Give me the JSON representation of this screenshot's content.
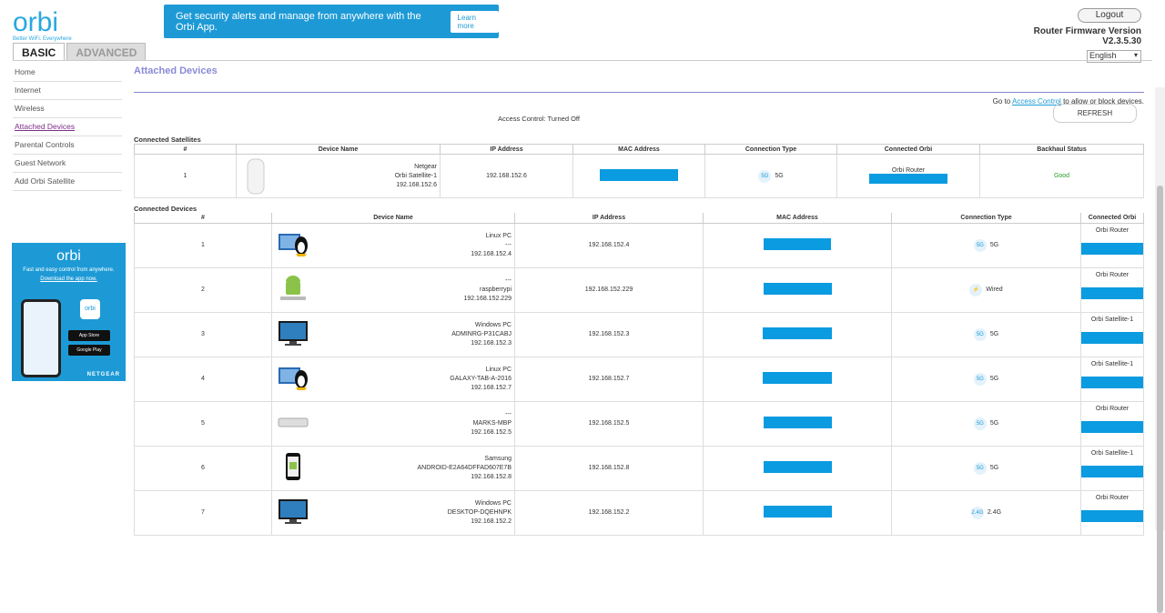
{
  "brand": {
    "logo": "orbi",
    "tagline": "Better WiFi. Everywhere"
  },
  "banner": {
    "text": "Get security alerts and manage from anywhere with the Orbi App.",
    "button": "Learn more",
    "close": "✕"
  },
  "tabs": {
    "basic": "BASIC",
    "advanced": "ADVANCED"
  },
  "header": {
    "logout": "Logout",
    "fw_label": "Router Firmware Version",
    "fw_version": "V2.3.5.30",
    "language": "English"
  },
  "sidebar": {
    "items": [
      {
        "label": "Home"
      },
      {
        "label": "Internet"
      },
      {
        "label": "Wireless"
      },
      {
        "label": "Attached Devices"
      },
      {
        "label": "Parental Controls"
      },
      {
        "label": "Guest Network"
      },
      {
        "label": "Add Orbi Satellite"
      }
    ]
  },
  "promo": {
    "logo": "orbi",
    "text": "Fast and easy control from anywhere.",
    "link": "Download the app now.",
    "app": "orbi",
    "app_store": "App Store",
    "google_play": "Google Play",
    "brand": "NETGEAR"
  },
  "main": {
    "title": "Attached Devices",
    "ac_prefix": "Go to",
    "ac_link": "Access Control",
    "ac_suffix": "to allow or block devices.",
    "ac_status": "Access Control: Turned Off",
    "refresh": "REFRESH"
  },
  "satellites": {
    "title": "Connected Satellites",
    "headers": [
      "#",
      "Device Name",
      "IP Address",
      "MAC Address",
      "Connection Type",
      "Connected Orbi",
      "Backhaul Status"
    ],
    "rows": [
      {
        "num": "1",
        "name1": "Netgear",
        "name2": "Orbi Satellite-1",
        "name3": "192.168.152.6",
        "ip": "192.168.152.6",
        "conn": "5G",
        "orbi": "Orbi Router",
        "status": "Good"
      }
    ]
  },
  "devices": {
    "title": "Connected Devices",
    "headers": [
      "#",
      "Device Name",
      "IP Address",
      "MAC Address",
      "Connection Type",
      "Connected Orbi"
    ],
    "rows": [
      {
        "num": "1",
        "name1": "Linux PC",
        "name2": "---",
        "name3": "192.168.152.4",
        "ip": "192.168.152.4",
        "conn": "5G",
        "orbi": "Orbi Router"
      },
      {
        "num": "2",
        "name1": "---",
        "name2": "raspberrypi",
        "name3": "192.168.152.229",
        "ip": "192.168.152.229",
        "conn": "Wired",
        "orbi": "Orbi Router"
      },
      {
        "num": "3",
        "name1": "Windows PC",
        "name2": "ADMINRG-P31CABJ",
        "name3": "192.168.152.3",
        "ip": "192.168.152.3",
        "conn": "5G",
        "orbi": "Orbi Satellite-1"
      },
      {
        "num": "4",
        "name1": "Linux PC",
        "name2": "GALAXY-TAB-A-2016",
        "name3": "192.168.152.7",
        "ip": "192.168.152.7",
        "conn": "5G",
        "orbi": "Orbi Satellite-1"
      },
      {
        "num": "5",
        "name1": "---",
        "name2": "MARKS-MBP",
        "name3": "192.168.152.5",
        "ip": "192.168.152.5",
        "conn": "5G",
        "orbi": "Orbi Router"
      },
      {
        "num": "6",
        "name1": "Samsung",
        "name2": "ANDROID-E2A64DFFAD607E7B",
        "name3": "192.168.152.8",
        "ip": "192.168.152.8",
        "conn": "5G",
        "orbi": "Orbi Satellite-1"
      },
      {
        "num": "7",
        "name1": "Windows PC",
        "name2": "DESKTOP-DQEHNPK",
        "name3": "192.168.152.2",
        "ip": "192.168.152.2",
        "conn": "2.4G",
        "orbi": "Orbi Router"
      }
    ]
  }
}
